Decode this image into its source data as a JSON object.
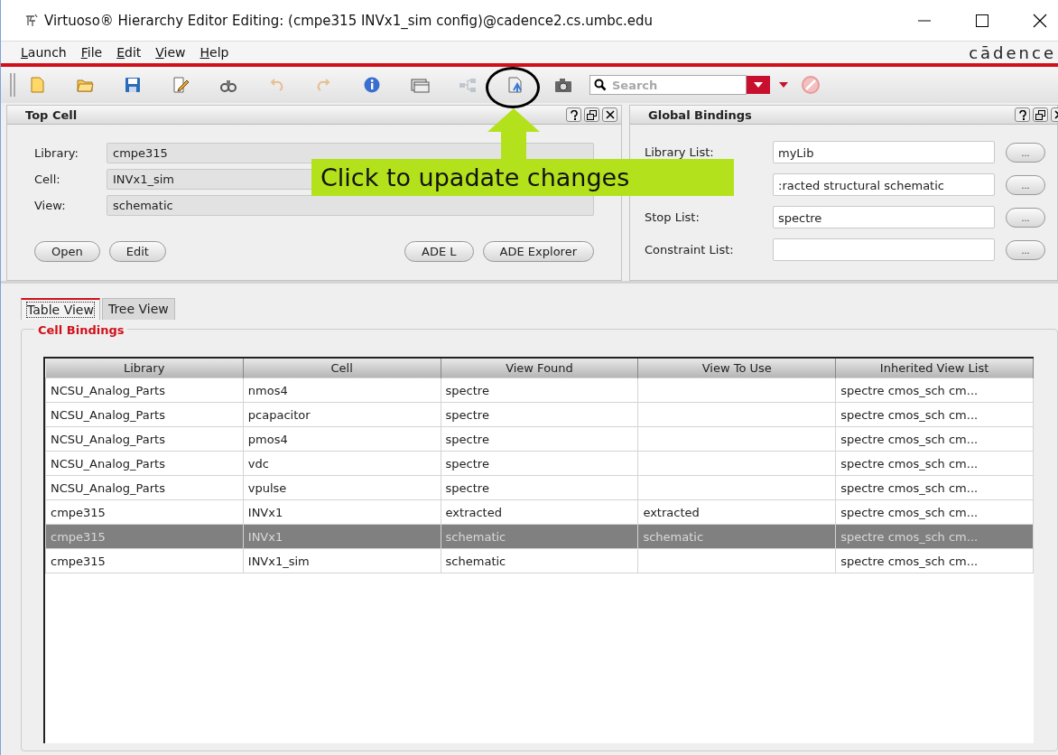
{
  "window": {
    "title": "Virtuoso® Hierarchy Editor Editing: (cmpe315 INVx1_sim config)@cadence2.cs.umbc.edu"
  },
  "menu": [
    {
      "label": "Launch"
    },
    {
      "label": "File"
    },
    {
      "label": "Edit"
    },
    {
      "label": "View"
    },
    {
      "label": "Help"
    }
  ],
  "brand": "cādence",
  "toolbar": [
    {
      "kind": "new",
      "disabled": false
    },
    {
      "kind": "open",
      "disabled": false
    },
    {
      "kind": "save",
      "disabled": false
    },
    {
      "kind": "edit",
      "disabled": false
    },
    {
      "kind": "binoculars",
      "disabled": false
    },
    {
      "kind": "undo",
      "disabled": true
    },
    {
      "kind": "redo",
      "disabled": true
    },
    {
      "kind": "info",
      "disabled": false
    },
    {
      "kind": "windows",
      "disabled": false
    },
    {
      "kind": "tree",
      "disabled": true
    },
    {
      "kind": "update",
      "disabled": false
    },
    {
      "kind": "camera",
      "disabled": false
    }
  ],
  "search": {
    "placeholder": "Search"
  },
  "top_cell": {
    "title": "Top Cell",
    "fields": [
      {
        "label": "Library:",
        "value": "cmpe315"
      },
      {
        "label": "Cell:",
        "value": "INVx1_sim"
      },
      {
        "label": "View:",
        "value": "schematic"
      }
    ],
    "buttons_left": [
      "Open",
      "Edit"
    ],
    "buttons_right": [
      "ADE L",
      "ADE Explorer"
    ]
  },
  "global_bindings": {
    "title": "Global Bindings",
    "fields": [
      {
        "label": "Library List:",
        "value": "myLib",
        "button": "..."
      },
      {
        "value": ":racted structural schematic",
        "button": "..."
      },
      {
        "label": "Stop List:",
        "value": "spectre",
        "button": "..."
      },
      {
        "label": "Constraint List:",
        "button": "..."
      }
    ]
  },
  "tabs": [
    {
      "label": "Table View",
      "selected": true
    },
    {
      "label": "Tree View",
      "selected": false
    }
  ],
  "group": {
    "title": "Cell Bindings"
  },
  "table": {
    "columns": [
      "Library",
      "Cell",
      "View Found",
      "View To Use",
      "Inherited View List"
    ],
    "rows": [
      {
        "cells": [
          "NCSU_Analog_Parts",
          "nmos4",
          "spectre",
          "",
          "spectre cmos_sch cm..."
        ],
        "selected": false
      },
      {
        "cells": [
          "NCSU_Analog_Parts",
          "pcapacitor",
          "spectre",
          "",
          "spectre cmos_sch cm..."
        ],
        "selected": false
      },
      {
        "cells": [
          "NCSU_Analog_Parts",
          "pmos4",
          "spectre",
          "",
          "spectre cmos_sch cm..."
        ],
        "selected": false
      },
      {
        "cells": [
          "NCSU_Analog_Parts",
          "vdc",
          "spectre",
          "",
          "spectre cmos_sch cm..."
        ],
        "selected": false
      },
      {
        "cells": [
          "NCSU_Analog_Parts",
          "vpulse",
          "spectre",
          "",
          "spectre cmos_sch cm..."
        ],
        "selected": false
      },
      {
        "cells": [
          "cmpe315",
          "INVx1",
          "extracted",
          "extracted",
          "spectre cmos_sch cm..."
        ],
        "selected": false
      },
      {
        "cells": [
          "cmpe315",
          "INVx1",
          "schematic",
          "schematic",
          "spectre cmos_sch cm..."
        ],
        "selected": true
      },
      {
        "cells": [
          "cmpe315",
          "INVx1_sim",
          "schematic",
          "",
          "spectre cmos_sch cm..."
        ],
        "selected": false
      }
    ]
  },
  "annotation": {
    "text": "Click to upadate changes"
  }
}
